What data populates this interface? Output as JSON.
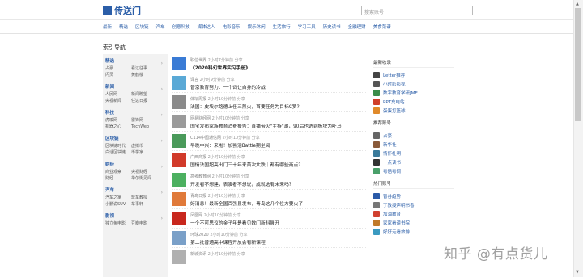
{
  "app": {
    "logo_text": "传送门",
    "search_placeholder": "搜索账号"
  },
  "nav": [
    "最新",
    "精选",
    "区块链",
    "汽车",
    "创意科技",
    "媒体达人",
    "电影音乐",
    "娱乐休闲",
    "生活旅行",
    "学习工具",
    "历史读书",
    "金融理财",
    "美食菜谱"
  ],
  "page_title": "索引导航",
  "sidebar": [
    {
      "head": "精选",
      "rows": [
        [
          "占豪",
          "看过往事"
        ],
        [
          "闪灵",
          "黄鹤楼"
        ]
      ]
    },
    {
      "head": "新闻",
      "rows": [
        [
          "人民网",
          "新闻瞭望"
        ],
        [
          "央视新闻",
          "任达日报"
        ]
      ]
    },
    {
      "head": "科技",
      "rows": [
        [
          "虎嗅网",
          "雷锋网"
        ],
        [
          "机器之心",
          "TechWeb"
        ]
      ]
    },
    {
      "head": "区块链",
      "rows": [
        [
          "区块链时代",
          "虚拟币"
        ],
        [
          "白话区块链",
          "币学家"
        ]
      ]
    },
    {
      "head": "财经",
      "rows": [
        [
          "商业观察",
          "央视财经"
        ],
        [
          "财经",
          "华尔街见闻"
        ]
      ]
    },
    {
      "head": "汽车",
      "rows": [
        [
          "汽车之家",
          "玩车教授"
        ],
        [
          "小鹏说SUV",
          "车事轩"
        ]
      ]
    },
    {
      "head": "影视",
      "rows": [
        [
          "独立鱼电影",
          "豆瓣电影"
        ]
      ]
    }
  ],
  "feed": [
    {
      "source": "职位世界",
      "time": "2小时7分钟前",
      "action": "分享",
      "title": "《2020科幻世界实习手册》",
      "color": "#3a7bd5",
      "bold": true
    },
    {
      "source": "译言",
      "time": "2小时9分钟前",
      "action": "分享",
      "title": "普京教育努力：一个词让自身的冷战",
      "color": "#5aa9d6",
      "bold": false
    },
    {
      "source": "体坛周报",
      "time": "2小时10分钟前",
      "action": "分享",
      "title": "法国：皮埃尔路德上任三烈火，首要任务为目标C罗？",
      "color": "#8a8a8a",
      "bold": false
    },
    {
      "source": "网易财经网",
      "time": "2小时10分钟前",
      "action": "分享",
      "title": "国宝发布家族教育消费报告：直播带火\"主持\"潮，90后也选到板块为吓马",
      "color": "#9a9a9a",
      "bold": false
    },
    {
      "source": "C114中国通信网",
      "time": "2小时10分钟前",
      "action": "分享",
      "title": "早晚中兴：来啦！加强活Battle期坐阅",
      "color": "#4a9a5a",
      "bold": false
    },
    {
      "source": "广西商报",
      "time": "2小时10分钟前",
      "action": "分享",
      "title": "国情法国超高出门三十年来首次大跌｜都有哪些商点？",
      "color": "#d13a2a",
      "bold": false
    },
    {
      "source": "高考教育网",
      "time": "2小时10分钟前",
      "action": "分享",
      "title": "开发者不想建，表演者不想说，成就选有未来吗？",
      "color": "#4cb060",
      "bold": false
    },
    {
      "source": "青岛日报",
      "time": "2小时10分钟前",
      "action": "分享",
      "title": "好消息！最新全国百强县发布，青岛这几个位方要火了！",
      "color": "#e07a3a",
      "bold": false
    },
    {
      "source": "凤凰网",
      "time": "2小时10分钟前",
      "action": "分享",
      "title": "一个不可思议的金子年是看见数门新科展开",
      "color": "#c8281e",
      "bold": false
    },
    {
      "source": "环球2020",
      "time": "2小时10分钟前",
      "action": "分享",
      "title": "第二批普通高中课程开放会有新课程",
      "color": "#7aa0c8",
      "bold": false
    },
    {
      "source": "新城资讯",
      "time": "2小时10分钟前",
      "action": "分享",
      "title": "",
      "color": "#b0b0b0",
      "bold": false
    }
  ],
  "right": [
    {
      "head": "最新收录",
      "items": [
        {
          "label": "Letter推荐",
          "color": "#444"
        },
        {
          "label": "小时影影视",
          "color": "#555"
        },
        {
          "label": "数字教育学研JME",
          "color": "#3a8c4a"
        },
        {
          "label": "PPT充电站",
          "color": "#d0402a"
        },
        {
          "label": "蛋蛋打篮球",
          "color": "#e08a2a"
        }
      ]
    },
    {
      "head": "推荐账号",
      "items": [
        {
          "label": "占豪",
          "color": "#666"
        },
        {
          "label": "新华社",
          "color": "#8a5a3a"
        },
        {
          "label": "情怀杜明",
          "color": "#3a7a9a"
        },
        {
          "label": "十点读书",
          "color": "#333"
        },
        {
          "label": "粤话粤调",
          "color": "#4aa06a"
        }
      ]
    },
    {
      "head": "热门账号",
      "items": [
        {
          "label": "智谷趋势",
          "color": "#2a5aa8"
        },
        {
          "label": "丁教授声明书香",
          "color": "#777"
        },
        {
          "label": "加油教育",
          "color": "#d04030"
        },
        {
          "label": "家家看读书院",
          "color": "#c07a2a"
        },
        {
          "label": "好好走看旅游",
          "color": "#3a9ac0"
        }
      ]
    }
  ],
  "watermark": "知乎 @有点货儿",
  "scrollbar": {
    "up": "▲",
    "down": "▼"
  }
}
